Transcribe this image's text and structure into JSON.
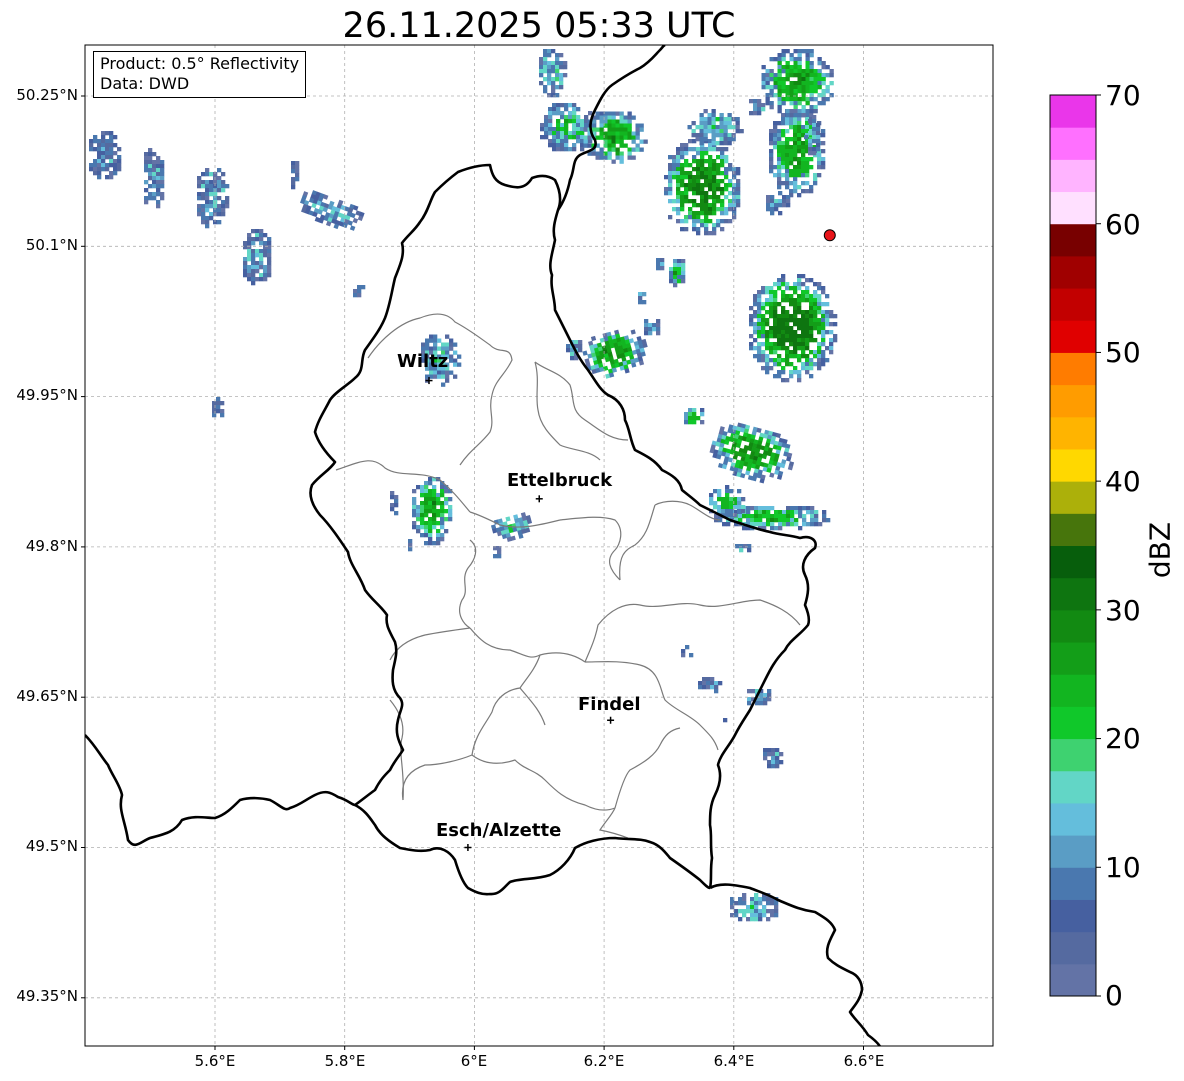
{
  "title": "26.11.2025 05:33 UTC",
  "info_box": {
    "product_line": "Product: 0.5° Reflectivity",
    "data_line": "Data: DWD"
  },
  "axes": {
    "lat_ticks": [
      "50.25°N",
      "50.1°N",
      "49.95°N",
      "49.8°N",
      "49.65°N",
      "49.5°N",
      "49.35°N"
    ],
    "lon_ticks": [
      "5.6°E",
      "5.8°E",
      "6°E",
      "6.2°E",
      "6.4°E",
      "6.6°E"
    ],
    "lat_range": [
      49.3,
      50.3
    ],
    "lon_range": [
      5.4,
      6.8
    ],
    "grid": true
  },
  "cities": [
    {
      "name": "Wiltz",
      "lon": 5.93,
      "lat": 49.966
    },
    {
      "name": "Ettelbruck",
      "lon": 6.1,
      "lat": 49.848
    },
    {
      "name": "Findel",
      "lon": 6.21,
      "lat": 49.627
    },
    {
      "name": "Esch/Alzette",
      "lon": 5.99,
      "lat": 49.5
    }
  ],
  "radar_site": {
    "lon": 6.548,
    "lat": 50.111,
    "color": "#e8141a"
  },
  "colorbar": {
    "label": "dBZ",
    "range": [
      0,
      70
    ],
    "tick_labels": [
      "0",
      "10",
      "20",
      "30",
      "40",
      "50",
      "60",
      "70"
    ],
    "colors": [
      "#6373a6",
      "#556aa0",
      "#4660a0",
      "#4a78af",
      "#5a9dc5",
      "#64bedc",
      "#62d6c6",
      "#3ed270",
      "#10c82a",
      "#12b520",
      "#139e18",
      "#128a12",
      "#0e7510",
      "#075e0c",
      "#47750c",
      "#acb00a",
      "#ffd800",
      "#ffb400",
      "#ff9c00",
      "#ff7c00",
      "#e00000",
      "#c20000",
      "#a00000",
      "#780000",
      "#ffe0ff",
      "#ffb4ff",
      "#ff70ff",
      "#ea36ea"
    ]
  }
}
